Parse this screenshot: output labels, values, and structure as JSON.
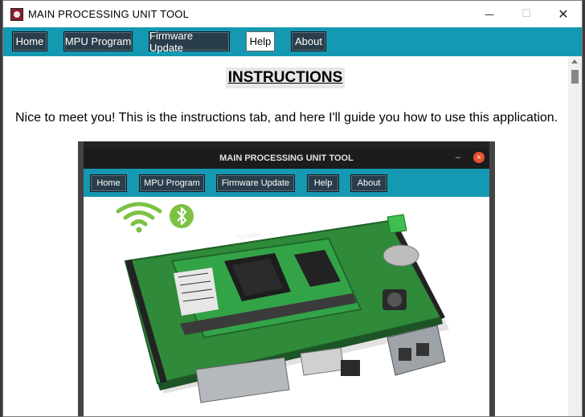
{
  "window": {
    "title": "MAIN PROCESSING UNIT TOOL",
    "controls": {
      "minimize": "—",
      "maximize": "☐",
      "close": "✕"
    }
  },
  "nav": {
    "items": [
      {
        "label": "Home"
      },
      {
        "label": "MPU Program"
      },
      {
        "label": "Firmware Update"
      },
      {
        "label": "Help",
        "active": true
      },
      {
        "label": "About"
      }
    ]
  },
  "content": {
    "heading": "INSTRUCTIONS",
    "intro": "Nice to meet you! This is the instructions tab, and here I'll guide you how to use this application."
  },
  "embedded_screenshot": {
    "title": "MAIN PROCESSING UNIT TOOL",
    "minimize": "–",
    "close": "×",
    "nav": [
      "Home",
      "MPU Program",
      "Firmware Update",
      "Help",
      "About"
    ],
    "board_label": "Toradex",
    "icons": [
      "wifi-icon",
      "bluetooth-icon"
    ]
  },
  "colors": {
    "accent": "#1598b1",
    "button": "#2a3d4a",
    "board_green": "#2f8a3a"
  }
}
